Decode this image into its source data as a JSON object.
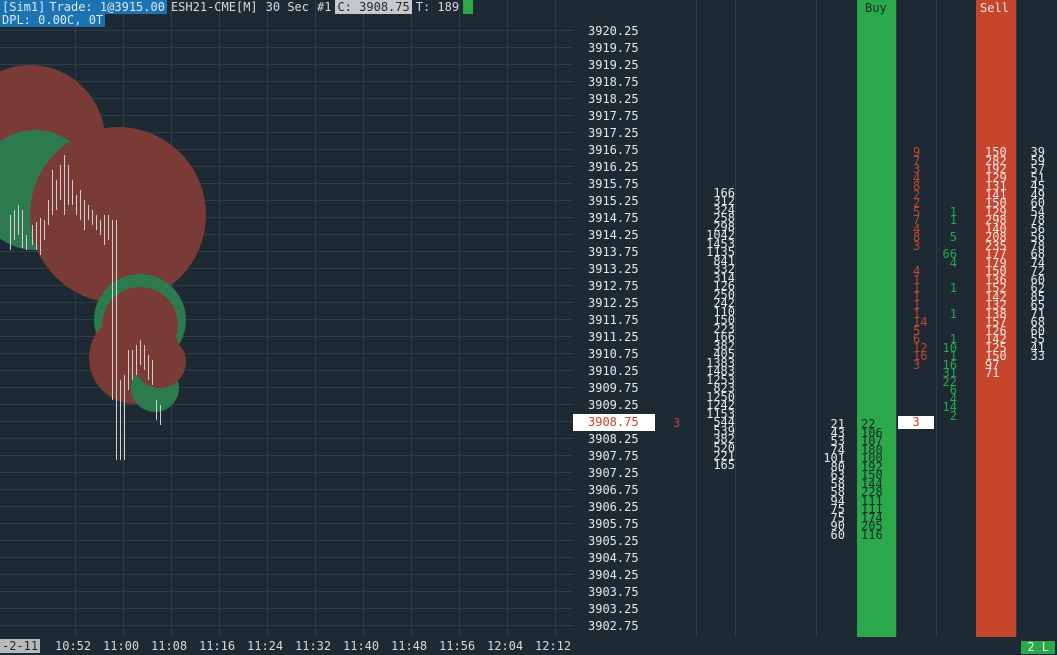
{
  "header": {
    "account": "[Sim1]",
    "trade": "Trade: 1@3915.00",
    "instrument": "ESH21-CME[M]",
    "interval": "30 Sec",
    "bar_no": "#1",
    "close": "C: 3908.75",
    "ticks": "T: 189"
  },
  "dpl": "DPL: 0.00C, 0T",
  "time_axis": {
    "date": "-2-11",
    "ticks": [
      "10:52",
      "11:00",
      "11:08",
      "11:16",
      "11:24",
      "11:32",
      "11:40",
      "11:48",
      "11:56",
      "12:04",
      "12:12"
    ]
  },
  "ladder": {
    "buy_title": "Buy",
    "sell_title": "Sell",
    "current_price": "3908.75",
    "current_side": "3",
    "last_trade_size": "3",
    "prices": [
      "3920.25",
      "3919.75",
      "3919.25",
      "3918.75",
      "3918.25",
      "3917.75",
      "3917.25",
      "3916.75",
      "3916.25",
      "3915.75",
      "3915.25",
      "3914.75",
      "3914.25",
      "3913.75",
      "3913.25",
      "3912.75",
      "3912.25",
      "3911.75",
      "3911.25",
      "3910.75",
      "3910.25",
      "3909.75",
      "3909.25",
      "3908.75",
      "3908.25",
      "3907.75",
      "3907.25",
      "3906.75",
      "3906.25",
      "3905.75",
      "3905.25",
      "3904.75",
      "3904.25",
      "3903.75",
      "3903.25",
      "3902.75",
      "3902.25"
    ],
    "profile_bid": [
      "",
      "",
      "",
      "",
      "",
      "",
      "",
      "166",
      "312",
      "324",
      "258",
      "298",
      "1042",
      "1453",
      "1135",
      "841",
      "332",
      "314",
      "126",
      "250",
      "242",
      "110",
      "150",
      "223",
      "166",
      "382",
      "405",
      "1383",
      "1483",
      "1253",
      "823",
      "1250",
      "1242",
      "1153",
      "544",
      "539",
      "382",
      "520",
      "221",
      "165"
    ],
    "bid_sizes": [
      "",
      "",
      "",
      "",
      "",
      "",
      "",
      "",
      "",
      "",
      "",
      "",
      "",
      "",
      "",
      "",
      "",
      "",
      "",
      "",
      "",
      "",
      "",
      "21",
      "43",
      "53",
      "74",
      "101",
      "80",
      "63",
      "58",
      "58",
      "94",
      "75",
      "75",
      "90",
      "60"
    ],
    "ask_sizes": [
      "",
      "",
      "",
      "",
      "",
      "",
      "",
      "",
      "",
      "",
      "",
      "",
      "",
      "",
      "",
      "",
      "",
      "",
      "",
      "",
      "",
      "",
      "",
      "22",
      "106",
      "107",
      "180",
      "100",
      "192",
      "150",
      "144",
      "228",
      "111",
      "111",
      "174",
      "205",
      "116"
    ],
    "sell_sizes": [
      "",
      "",
      "",
      "",
      "",
      "",
      "",
      "150",
      "282",
      "192",
      "129",
      "131",
      "141",
      "150",
      "129",
      "298",
      "140",
      "208",
      "235",
      "177",
      "179",
      "150",
      "136",
      "152",
      "142",
      "132",
      "138",
      "157",
      "126",
      "142",
      "125",
      "150",
      "97",
      "71"
    ],
    "sell_right": [
      "",
      "",
      "",
      "",
      "",
      "",
      "",
      "39",
      "59",
      "57",
      "51",
      "45",
      "49",
      "60",
      "54",
      "78",
      "56",
      "56",
      "78",
      "68",
      "74",
      "72",
      "60",
      "62",
      "85",
      "65",
      "71",
      "68",
      "60",
      "55",
      "41",
      "33"
    ],
    "buy_delta_red": [
      "",
      "",
      "",
      "",
      "",
      "",
      "",
      "9",
      "7",
      "3",
      "4",
      "8",
      "2",
      "2",
      "5",
      "7",
      "4",
      "8",
      "3",
      "",
      "",
      "4",
      "1",
      "1",
      "1",
      "1",
      "1",
      "14",
      "5",
      "6",
      "12",
      "16",
      "3"
    ],
    "buy_delta_green": [
      "",
      "",
      "",
      "",
      "",
      "",
      "",
      "",
      "",
      "",
      "",
      "",
      "",
      "",
      "1",
      "1",
      "",
      "5",
      "",
      "66",
      "4",
      "",
      "",
      "1",
      "",
      "",
      "1",
      "",
      "",
      "1",
      "10",
      "1",
      "16",
      "31",
      "22",
      "6",
      "4",
      "14",
      "2"
    ]
  },
  "status": {
    "right_badge": "2 L"
  },
  "colors": {
    "background": "#1e2a33",
    "buy": "#2aa84a",
    "sell": "#c7452d",
    "header_blue": "#1b73b3"
  }
}
